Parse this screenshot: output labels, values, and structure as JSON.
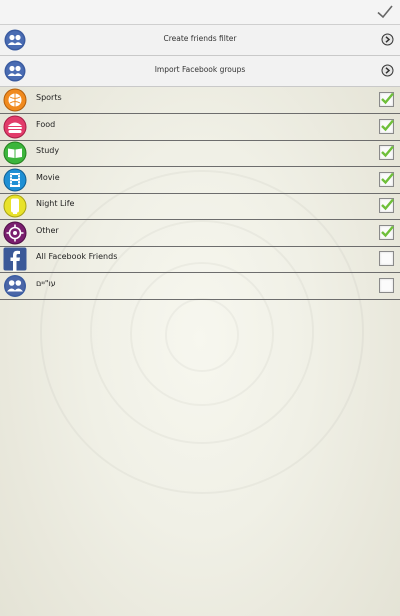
{
  "actions": [
    {
      "label": "Create friends filter"
    },
    {
      "label": "Import Facebook groups"
    }
  ],
  "categories": [
    {
      "label": "Sports",
      "checked": true,
      "color": "#f08a1e"
    },
    {
      "label": "Food",
      "checked": true,
      "color": "#e23b6a"
    },
    {
      "label": "Study",
      "checked": true,
      "color": "#3cb53c"
    },
    {
      "label": "Movie",
      "checked": true,
      "color": "#1e8fd4"
    },
    {
      "label": "Night Life",
      "checked": true,
      "color": "#e8e22a"
    },
    {
      "label": "Other",
      "checked": true,
      "color": "#7a1e6e"
    },
    {
      "label": "All Facebook Friends",
      "checked": false,
      "color": "#3b5998"
    },
    {
      "label": "עו\"יים",
      "checked": false,
      "color": "#4a66a8"
    }
  ]
}
